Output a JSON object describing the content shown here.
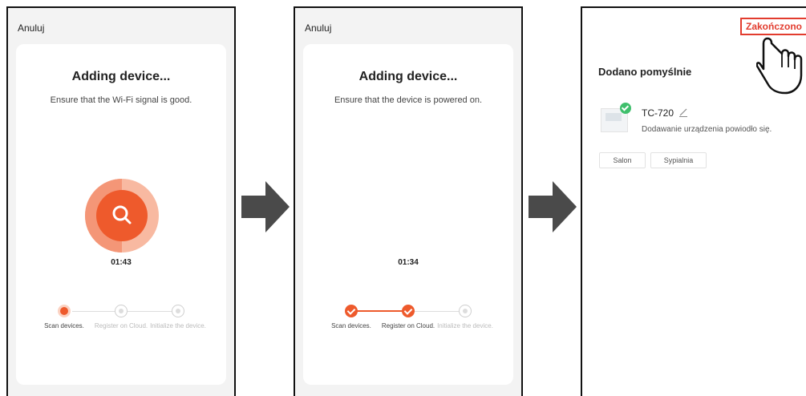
{
  "screens": [
    {
      "cancel_label": "Anuluj",
      "title": "Adding device...",
      "subtitle": "Ensure that the Wi-Fi signal is good.",
      "timer": "01:43",
      "steps": [
        {
          "label": "Scan devices.",
          "state": "active"
        },
        {
          "label": "Register on Cloud.",
          "state": "pending"
        },
        {
          "label": "Initialize the device.",
          "state": "pending"
        }
      ]
    },
    {
      "cancel_label": "Anuluj",
      "title": "Adding device...",
      "subtitle": "Ensure that the device is powered on.",
      "timer": "01:34",
      "steps": [
        {
          "label": "Scan devices.",
          "state": "done"
        },
        {
          "label": "Register on Cloud.",
          "state": "done"
        },
        {
          "label": "Initialize the device.",
          "state": "pending"
        }
      ]
    },
    {
      "done_label": "Zakończono",
      "title": "Dodano pomyślnie",
      "device": {
        "name": "TC-720",
        "status": "Dodawanie urządzenia powiodło się."
      },
      "rooms": [
        "Salon",
        "Sypialnia"
      ]
    }
  ],
  "colors": {
    "accent": "#ee5a2c",
    "success": "#3fbf6c",
    "highlight": "#e23c2e",
    "arrow": "#4a4a4a"
  },
  "icons": [
    "search-icon",
    "cloud-icon",
    "initialize-icon",
    "check-icon",
    "pencil-icon",
    "pointing-hand-icon",
    "right-arrow-icon"
  ]
}
